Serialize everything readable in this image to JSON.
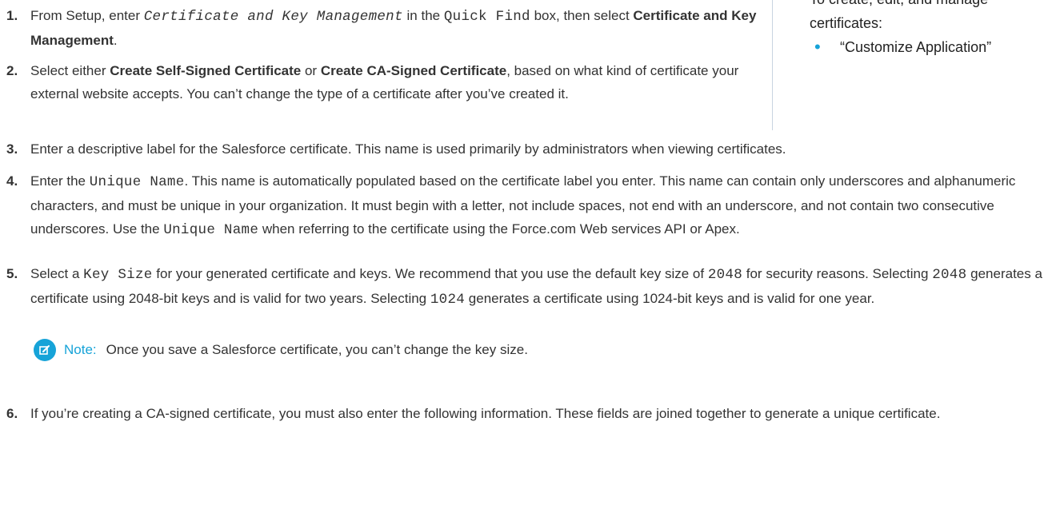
{
  "sidebar": {
    "partial_line": "To create, edit, and manage",
    "line2": "certificates:",
    "permission": "“Customize Application”"
  },
  "steps": [
    {
      "num": "1.",
      "a": "From Setup, enter ",
      "code1": "Certificate and Key Management",
      "b": " in the ",
      "code2": "Quick Find",
      "c": " box, then select ",
      "bold1": "Certificate and Key Management",
      "d": "."
    },
    {
      "num": "2.",
      "a": "Select either ",
      "bold1": "Create Self-Signed Certificate",
      "b": " or ",
      "bold2": "Create CA-Signed Certificate",
      "c": ", based on what kind of certificate your external website accepts. You can’t change the type of a certificate after you’ve created it."
    },
    {
      "num": "3.",
      "a": "Enter a descriptive label for the Salesforce certificate. This name is used primarily by administrators when viewing certificates."
    },
    {
      "num": "4.",
      "a": "Enter the ",
      "code1": "Unique Name",
      "b": ". This name is automatically populated based on the certificate label you enter. This name can contain only underscores and alphanumeric characters, and must be unique in your organization. It must begin with a letter, not include spaces, not end with an underscore, and not contain two consecutive underscores. Use the ",
      "code2": "Unique Name",
      "c": " when referring to the certificate using the Force.com Web services API or Apex."
    },
    {
      "num": "5.",
      "a": "Select a ",
      "code1": "Key Size",
      "b": " for your generated certificate and keys. We recommend that you use the default key size of ",
      "code2": "2048",
      "c": " for security reasons. Selecting ",
      "code3": "2048",
      "d": " generates a certificate using 2048-bit keys and is valid for two years. Selecting ",
      "code4": "1024",
      "e": " generates a certificate using 1024-bit keys and is valid for one year."
    },
    {
      "num": "6.",
      "a": "If you’re creating a CA-signed certificate, you must also enter the following information. These fields are joined together to generate a unique certificate."
    }
  ],
  "note": {
    "icon": "edit-note-icon",
    "label": "Note:",
    "text": "Once you save a Salesforce certificate, you can’t change the key size."
  },
  "colors": {
    "accent": "#16a3d8",
    "text": "#333333"
  }
}
